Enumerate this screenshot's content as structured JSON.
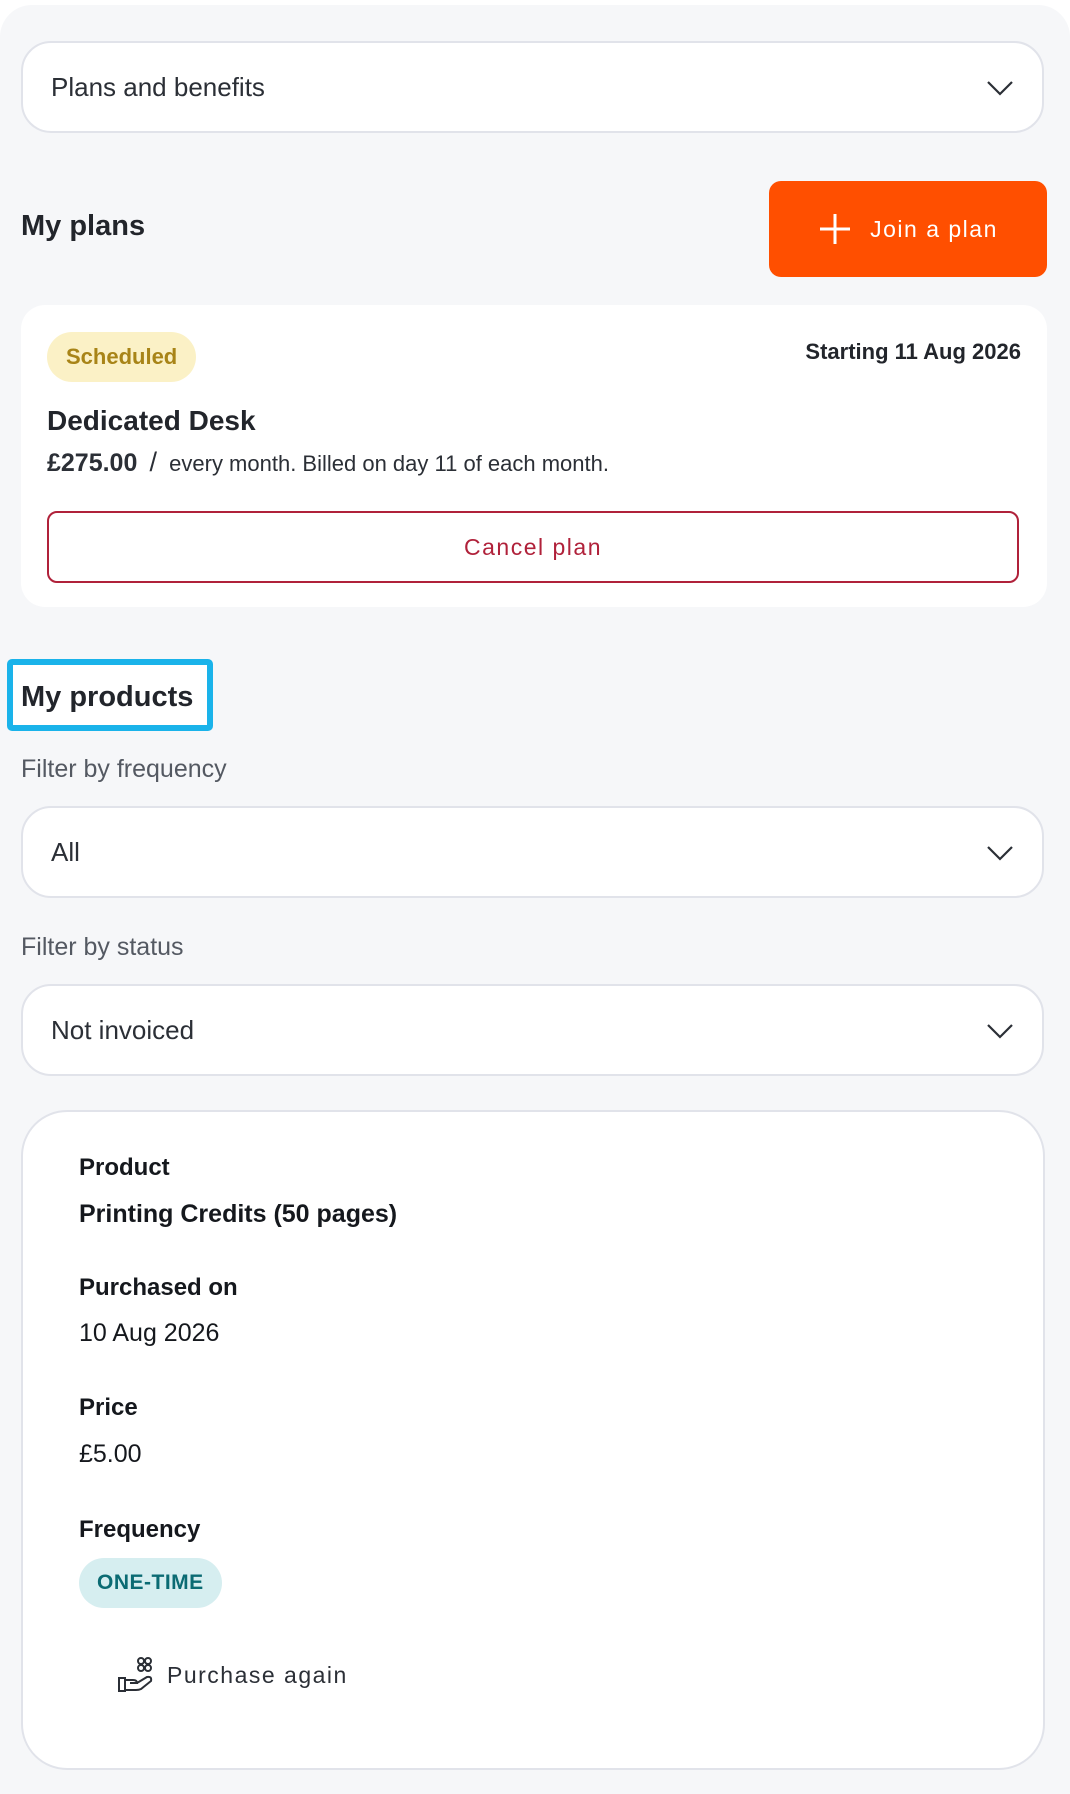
{
  "nav_select": {
    "value": "Plans and benefits",
    "icon": "chevron-down-icon"
  },
  "plans": {
    "title": "My plans",
    "join_button": {
      "label": "Join a plan",
      "icon": "plus-icon"
    },
    "card": {
      "status": "Scheduled",
      "starting": "Starting 11 Aug 2026",
      "name": "Dedicated Desk",
      "price": "£275.00",
      "separator": "/",
      "billing": "every month. Billed on day 11 of each month.",
      "cancel_label": "Cancel plan"
    }
  },
  "products": {
    "title": "My products",
    "filter_frequency": {
      "label": "Filter by frequency",
      "value": "All"
    },
    "filter_status": {
      "label": "Filter by status",
      "value": "Not invoiced"
    },
    "item": {
      "product_label": "Product",
      "product_value": "Printing Credits (50 pages)",
      "purchased_label": "Purchased on",
      "purchased_value": "10 Aug 2026",
      "price_label": "Price",
      "price_value": "£5.00",
      "frequency_label": "Frequency",
      "frequency_value": "ONE-TIME",
      "action_label": "Purchase again",
      "action_icon": "hand-gift-icon"
    }
  },
  "colors": {
    "accent": "#ff4f00",
    "danger": "#b0213a",
    "highlight": "#1ab3ea",
    "scheduled_bg": "#fbf1c6",
    "scheduled_text": "#a88417",
    "onetime_bg": "#d6eef0",
    "onetime_text": "#0b6b73"
  }
}
